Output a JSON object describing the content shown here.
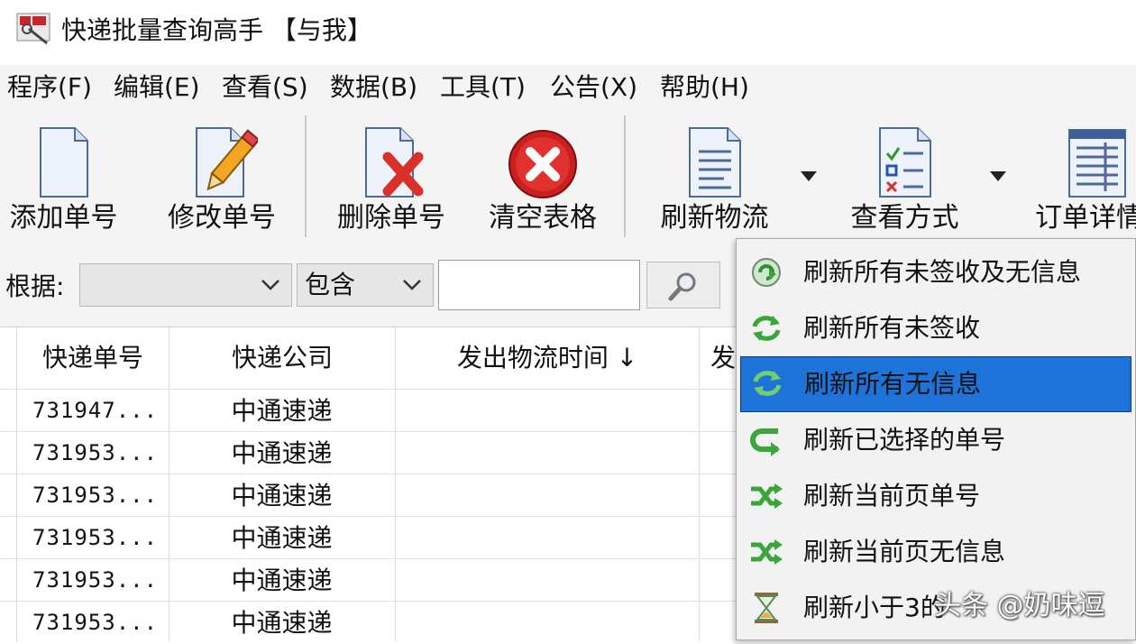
{
  "window": {
    "title": "快递批量查询高手 【与我】"
  },
  "menu": [
    {
      "label": "程序(F)"
    },
    {
      "label": "编辑(E)"
    },
    {
      "label": "查看(S)"
    },
    {
      "label": "数据(B)"
    },
    {
      "label": "工具(T)"
    },
    {
      "label": "公告(X)"
    },
    {
      "label": "帮助(H)"
    }
  ],
  "toolbar": {
    "add": "添加单号",
    "edit": "修改单号",
    "delete": "删除单号",
    "clear": "清空表格",
    "refresh": "刷新物流",
    "view": "查看方式",
    "order": "订单详情"
  },
  "filter": {
    "label": "根据:",
    "field_value": "",
    "mode_value": "包含",
    "query_value": ""
  },
  "table": {
    "columns": [
      "快递单号",
      "快递公司",
      "发出物流时间 ↓",
      "发"
    ],
    "rows": [
      {
        "number": "731947...",
        "company": "中通速递"
      },
      {
        "number": "731953...",
        "company": "中通速递"
      },
      {
        "number": "731953...",
        "company": "中通速递"
      },
      {
        "number": "731953...",
        "company": "中通速递"
      },
      {
        "number": "731953...",
        "company": "中通速递"
      },
      {
        "number": "731953...",
        "company": "中通速递"
      }
    ]
  },
  "refresh_menu": {
    "items": [
      {
        "label": "刷新所有未签收及无信息",
        "icon": "refresh-circle-icon"
      },
      {
        "label": "刷新所有未签收",
        "icon": "refresh-arrows-icon"
      },
      {
        "label": "刷新所有无信息",
        "icon": "refresh-arrows-icon",
        "selected": true
      },
      {
        "label": "刷新已选择的单号",
        "icon": "return-arrow-icon"
      },
      {
        "label": "刷新当前页单号",
        "icon": "shuffle-icon"
      },
      {
        "label": "刷新当前页无信息",
        "icon": "shuffle-icon"
      },
      {
        "label": "刷新小于3的",
        "icon": "hourglass-icon"
      }
    ]
  },
  "watermark": "头条 @奶味逗",
  "colors": {
    "selection": "#1e73d9",
    "chrome": "#f4f4f4",
    "delete_red": "#d9302a",
    "refresh_green": "#3aa63a"
  }
}
